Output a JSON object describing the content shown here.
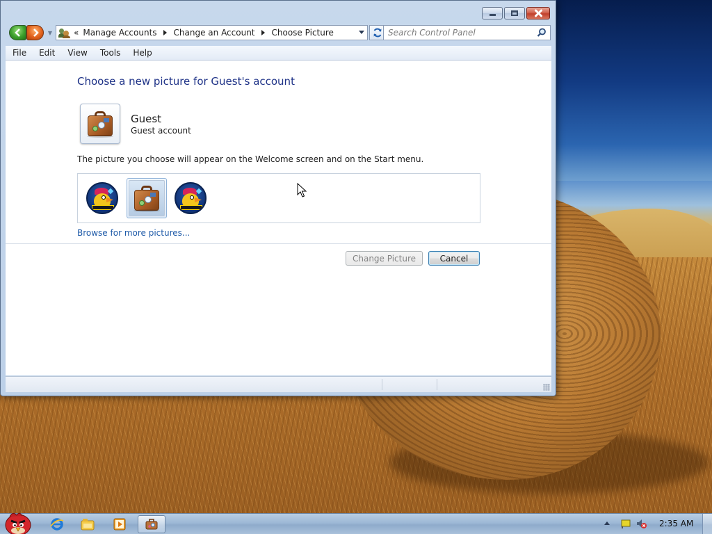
{
  "window": {
    "breadcrumb": {
      "overflow": "«",
      "items": [
        "Manage Accounts",
        "Change an Account",
        "Choose Picture"
      ]
    },
    "search": {
      "placeholder": "Search Control Panel"
    },
    "menu": [
      "File",
      "Edit",
      "View",
      "Tools",
      "Help"
    ]
  },
  "content": {
    "heading": "Choose a new picture for Guest's account",
    "account": {
      "name": "Guest",
      "type": "Guest account"
    },
    "instruction": "The picture you choose will appear on the Welcome screen and on the Start menu.",
    "pictures": [
      {
        "icon": "angry-birds-icon",
        "selected": false
      },
      {
        "icon": "suitcase-icon",
        "selected": true
      },
      {
        "icon": "angry-birds-icon",
        "selected": false
      }
    ],
    "browse_link": "Browse for more pictures...",
    "buttons": {
      "change": "Change Picture",
      "cancel": "Cancel"
    }
  },
  "taskbar": {
    "clock": "2:35 AM",
    "pinned": [
      "internet-explorer-icon",
      "windows-explorer-icon",
      "media-player-icon",
      "control-panel-icon"
    ]
  },
  "colors": {
    "heading": "#1e3287",
    "link": "#1e5aa8",
    "accent_close": "#c1402b"
  }
}
